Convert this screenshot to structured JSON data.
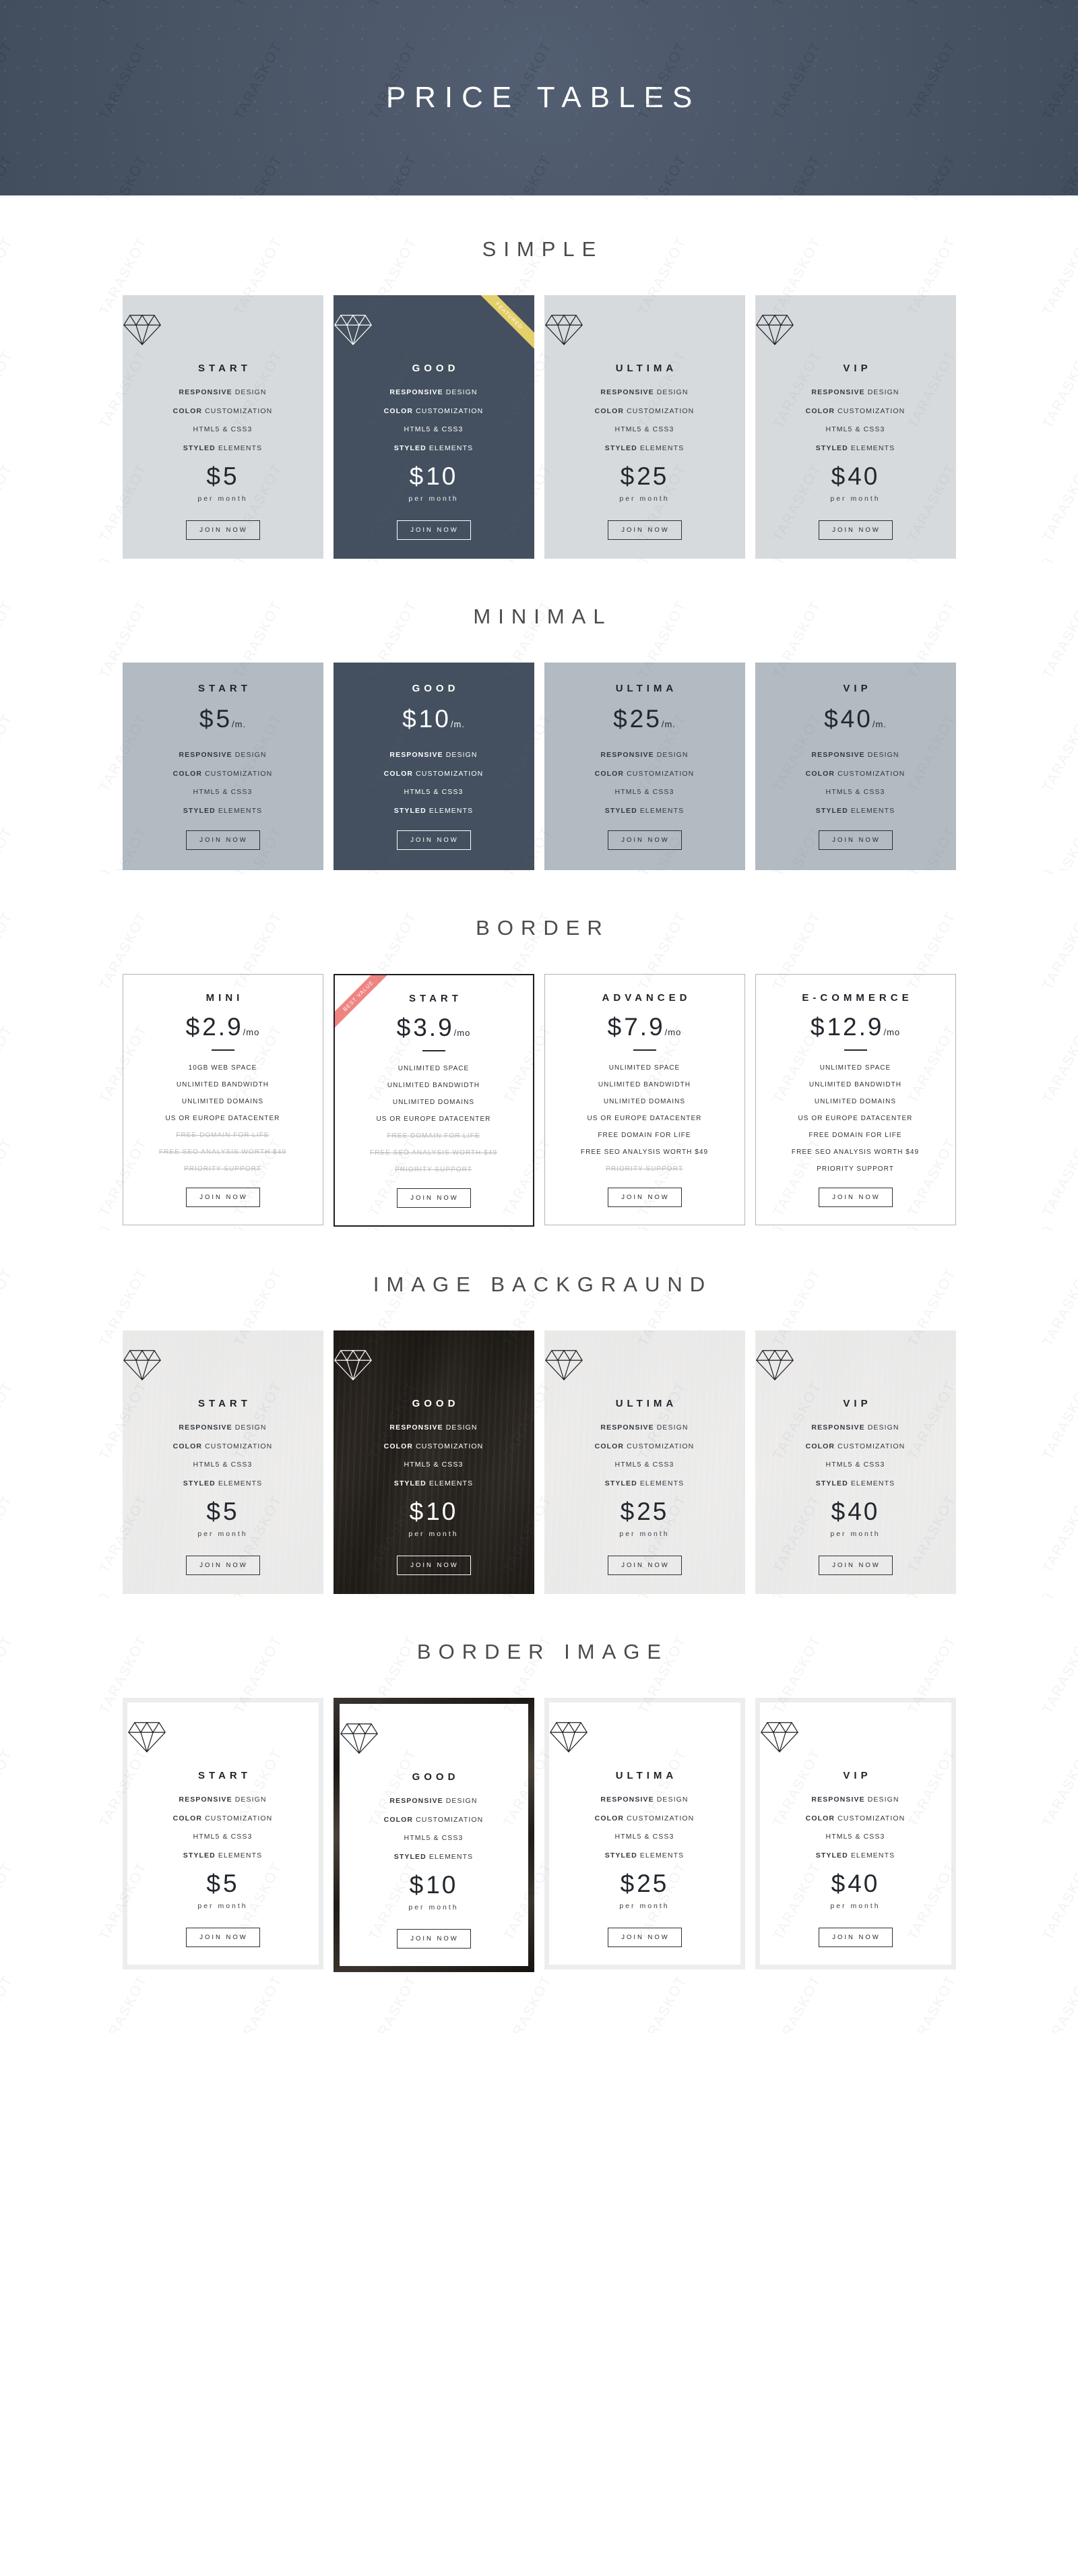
{
  "hero": {
    "title": "PRICE TABLES"
  },
  "watermark": {
    "text": "TARASKOT"
  },
  "colors": {
    "hero_bg": "#4a5566",
    "card_light": "#d7dadd",
    "card_dark": "#44505f",
    "card_minimal": "#b2bac2",
    "ribbon_featured": "#e4cf6a",
    "ribbon_best_value": "#ef8480",
    "text_dark": "#23272e",
    "text_muted": "#b9bcc1"
  },
  "common": {
    "cta_label": "JOIN NOW",
    "per_month": "per month",
    "suffix_m": "/m.",
    "suffix_mo": "/mo",
    "currency": "$",
    "ribbon_featured_label": "FEATURED",
    "ribbon_best_value_label": "BEST VALUE",
    "features_basic": [
      {
        "strong": "RESPONSIVE",
        "rest": " DESIGN"
      },
      {
        "strong": "COLOR",
        "rest": " CUSTOMIZATION"
      },
      {
        "strong": "",
        "rest": "HTML5 & CSS3"
      },
      {
        "strong": "STYLED",
        "rest": " ELEMENTS"
      }
    ]
  },
  "sections": [
    {
      "id": "simple",
      "title": "SIMPLE",
      "cards": [
        {
          "name": "START",
          "price": "5",
          "per": "per month",
          "theme": "light",
          "ribbon": null
        },
        {
          "name": "GOOD",
          "price": "10",
          "per": "per month",
          "theme": "dark",
          "ribbon": "FEATURED"
        },
        {
          "name": "ULTIMA",
          "price": "25",
          "per": "per month",
          "theme": "light",
          "ribbon": null
        },
        {
          "name": "VIP",
          "price": "40",
          "per": "per month",
          "theme": "light",
          "ribbon": null
        }
      ]
    },
    {
      "id": "minimal",
      "title": "MINIMAL",
      "cards": [
        {
          "name": "START",
          "price": "5",
          "suffix": "/m.",
          "theme": "light",
          "ribbon": null
        },
        {
          "name": "GOOD",
          "price": "10",
          "suffix": "/m.",
          "theme": "dark",
          "ribbon": null
        },
        {
          "name": "ULTIMA",
          "price": "25",
          "suffix": "/m.",
          "theme": "light",
          "ribbon": null
        },
        {
          "name": "VIP",
          "price": "40",
          "suffix": "/m.",
          "theme": "light",
          "ribbon": null
        }
      ]
    },
    {
      "id": "border",
      "title": "BORDER",
      "features": [
        "10GB WEB SPACE",
        "UNLIMITED BANDWIDTH",
        "UNLIMITED DOMAINS",
        "US OR EUROPE DATACENTER",
        "FREE DOMAIN FOR LIFE",
        "FREE SEO ANALYSIS WORTH $49",
        "PRIORITY SUPPORT"
      ],
      "cards": [
        {
          "name": "MINI",
          "price": "2.9",
          "suffix": "/mo",
          "ribbon": null,
          "active": false,
          "features": [
            {
              "label": "10GB WEB SPACE",
              "enabled": true
            },
            {
              "label": "UNLIMITED BANDWIDTH",
              "enabled": true
            },
            {
              "label": "UNLIMITED DOMAINS",
              "enabled": true
            },
            {
              "label": "US OR EUROPE DATACENTER",
              "enabled": true
            },
            {
              "label": "FREE DOMAIN FOR LIFE",
              "enabled": false
            },
            {
              "label": "FREE SEO ANALYSIS WORTH $49",
              "enabled": false
            },
            {
              "label": "PRIORITY SUPPORT",
              "enabled": false
            }
          ]
        },
        {
          "name": "START",
          "price": "3.9",
          "suffix": "/mo",
          "ribbon": "BEST VALUE",
          "active": true,
          "features": [
            {
              "label": "UNLIMITED SPACE",
              "enabled": true
            },
            {
              "label": "UNLIMITED BANDWIDTH",
              "enabled": true
            },
            {
              "label": "UNLIMITED DOMAINS",
              "enabled": true
            },
            {
              "label": "US OR EUROPE DATACENTER",
              "enabled": true
            },
            {
              "label": "FREE DOMAIN FOR LIFE",
              "enabled": false
            },
            {
              "label": "FREE SEO ANALYSIS WORTH $49",
              "enabled": false
            },
            {
              "label": "PRIORITY SUPPORT",
              "enabled": false
            }
          ]
        },
        {
          "name": "ADVANCED",
          "price": "7.9",
          "suffix": "/mo",
          "ribbon": null,
          "active": false,
          "features": [
            {
              "label": "UNLIMITED SPACE",
              "enabled": true
            },
            {
              "label": "UNLIMITED BANDWIDTH",
              "enabled": true
            },
            {
              "label": "UNLIMITED DOMAINS",
              "enabled": true
            },
            {
              "label": "US OR EUROPE DATACENTER",
              "enabled": true
            },
            {
              "label": "FREE DOMAIN FOR LIFE",
              "enabled": true
            },
            {
              "label": "FREE SEO ANALYSIS WORTH $49",
              "enabled": true
            },
            {
              "label": "PRIORITY SUPPORT",
              "enabled": false
            }
          ]
        },
        {
          "name": "E-COMMERCE",
          "price": "12.9",
          "suffix": "/mo",
          "ribbon": null,
          "active": false,
          "features": [
            {
              "label": "UNLIMITED SPACE",
              "enabled": true
            },
            {
              "label": "UNLIMITED BANDWIDTH",
              "enabled": true
            },
            {
              "label": "UNLIMITED DOMAINS",
              "enabled": true
            },
            {
              "label": "US OR EUROPE DATACENTER",
              "enabled": true
            },
            {
              "label": "FREE DOMAIN FOR LIFE",
              "enabled": true
            },
            {
              "label": "FREE SEO ANALYSIS WORTH $49",
              "enabled": true
            },
            {
              "label": "PRIORITY SUPPORT",
              "enabled": true
            }
          ]
        }
      ]
    },
    {
      "id": "image-background",
      "title": "IMAGE BACKGRAUND",
      "cards": [
        {
          "name": "START",
          "price": "5",
          "per": "per month",
          "theme": "light",
          "ribbon": null
        },
        {
          "name": "GOOD",
          "price": "10",
          "per": "per month",
          "theme": "dark",
          "ribbon": null
        },
        {
          "name": "ULTIMA",
          "price": "25",
          "per": "per month",
          "theme": "light",
          "ribbon": null
        },
        {
          "name": "VIP",
          "price": "40",
          "per": "per month",
          "theme": "light",
          "ribbon": null
        }
      ]
    },
    {
      "id": "border-image",
      "title": "BORDER IMAGE",
      "cards": [
        {
          "name": "START",
          "price": "5",
          "per": "per month",
          "frame": "light",
          "ribbon": null
        },
        {
          "name": "GOOD",
          "price": "10",
          "per": "per month",
          "frame": "dark",
          "ribbon": null
        },
        {
          "name": "ULTIMA",
          "price": "25",
          "per": "per month",
          "frame": "light",
          "ribbon": null
        },
        {
          "name": "VIP",
          "price": "40",
          "per": "per month",
          "frame": "light",
          "ribbon": null
        }
      ]
    }
  ]
}
